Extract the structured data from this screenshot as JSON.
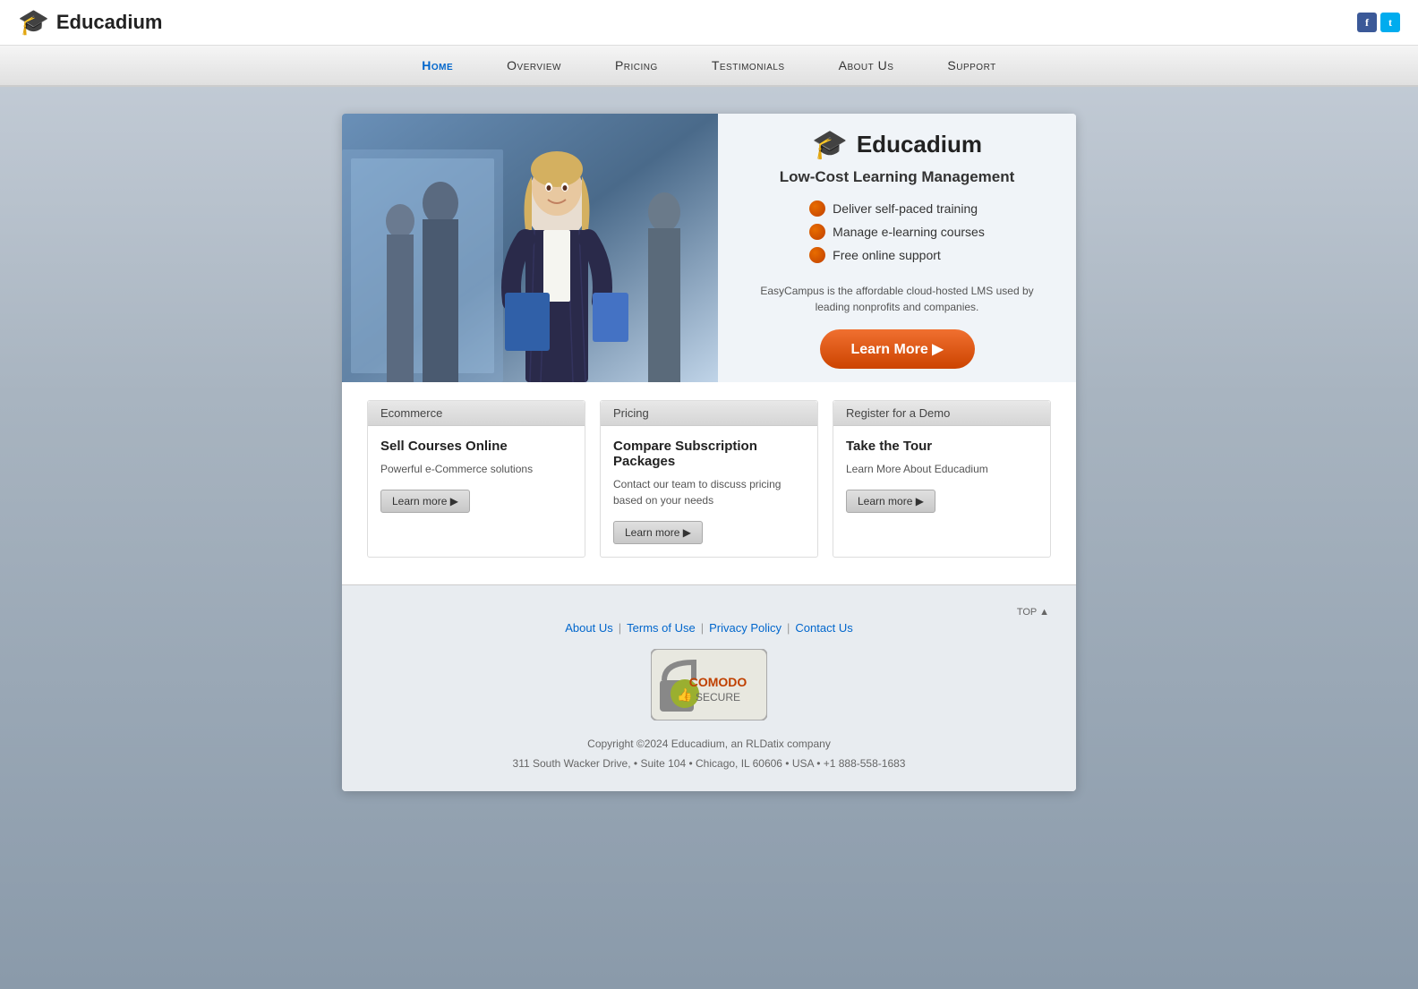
{
  "header": {
    "logo_icon": "🎓",
    "logo_text": "Educadium",
    "social": {
      "facebook_label": "f",
      "twitter_label": "t"
    }
  },
  "nav": {
    "items": [
      {
        "label": "Home",
        "active": true
      },
      {
        "label": "Overview",
        "active": false
      },
      {
        "label": "Pricing",
        "active": false
      },
      {
        "label": "Testimonials",
        "active": false
      },
      {
        "label": "About Us",
        "active": false
      },
      {
        "label": "Support",
        "active": false
      }
    ]
  },
  "hero": {
    "brand_icon": "🎓",
    "brand_name": "Educadium",
    "tagline": "Low-Cost Learning Management",
    "features": [
      "Deliver self-paced training",
      "Manage e-learning courses",
      "Free online support"
    ],
    "description": "EasyCampus is the affordable cloud-hosted LMS used\nby leading nonprofits and companies.",
    "learn_more_label": "Learn More ▶"
  },
  "cards": [
    {
      "tab": "Ecommerce",
      "title": "Sell Courses Online",
      "text": "Powerful e-Commerce solutions",
      "btn_label": "Learn more  ▶"
    },
    {
      "tab": "Pricing",
      "title": "Compare Subscription Packages",
      "text": "Contact our team to discuss pricing based on your needs",
      "btn_label": "Learn more  ▶"
    },
    {
      "tab": "Register for a Demo",
      "title": "Take the Tour",
      "text": "Learn More About Educadium",
      "btn_label": "Learn more  ▶"
    }
  ],
  "footer": {
    "top_label": "TOP ▲",
    "links": [
      {
        "label": "About Us"
      },
      {
        "label": "Terms of Use"
      },
      {
        "label": "Privacy Policy"
      },
      {
        "label": "Contact Us"
      }
    ],
    "copyright": "Copyright ©2024 Educadium, an RLDatix company",
    "address": "311 South Wacker Drive, • Suite 104 • Chicago, IL 60606 • USA • +1 888-558-1683",
    "comodo_text": "COMODO",
    "comodo_sub": "SECURE"
  }
}
